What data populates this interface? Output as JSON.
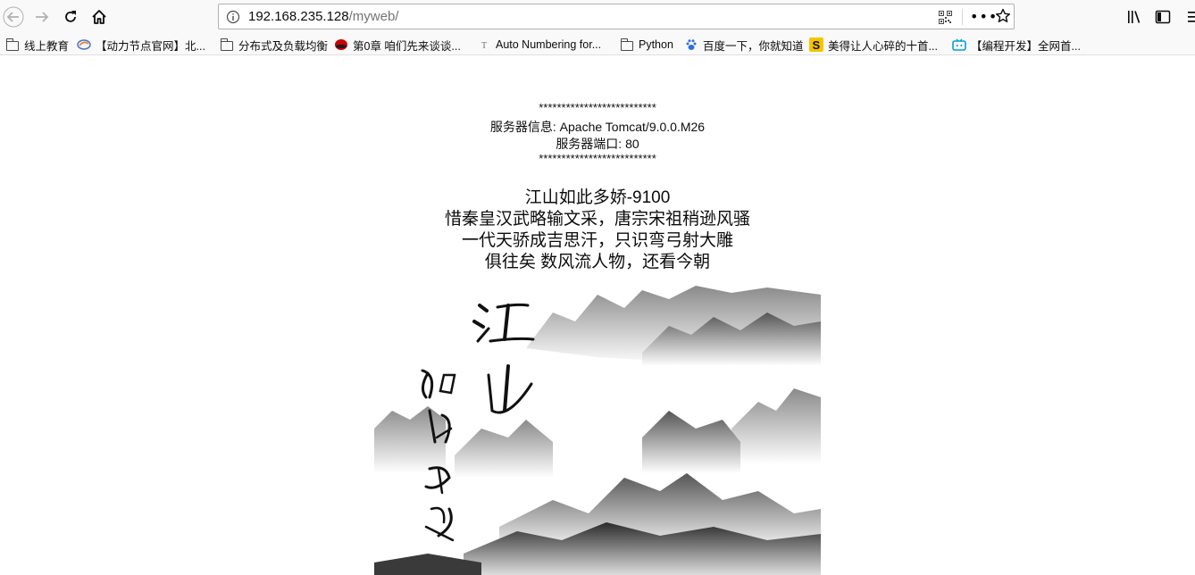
{
  "browser": {
    "url_host": "192.168.235.128",
    "url_path": "/myweb/",
    "more_label": "•••"
  },
  "bookmarks": [
    {
      "label": "线上教育",
      "icon": "folder-icon"
    },
    {
      "label": "【动力节点官网】北...",
      "icon": "site-icon"
    },
    {
      "label": "分布式及负载均衡",
      "icon": "folder-icon"
    },
    {
      "label": "第0章 咱们先来谈谈...",
      "icon": "redhat-icon"
    },
    {
      "label": "Auto Numbering for...",
      "icon": "page-icon"
    },
    {
      "label": "Python",
      "icon": "folder-icon"
    },
    {
      "label": "百度一下，你就知道",
      "icon": "baidu-paw-icon"
    },
    {
      "label": "美得让人心碎的十首...",
      "icon": "s-logo-icon"
    },
    {
      "label": "【编程开发】全网首...",
      "icon": "bilibili-tv-icon"
    }
  ],
  "page": {
    "stars_top": "**************************",
    "server_info": "服务器信息: Apache Tomcat/9.0.0.M26",
    "server_port": "服务器端口: 80",
    "stars_bottom": "**************************",
    "poem": [
      "江山如此多娇-9100",
      "惜秦皇汉武略输文采，唐宗宋祖稍逊风骚",
      "一代天骄成吉思汗，只识弯弓射大雕",
      "俱往矣 数风流人物，还看今朝"
    ]
  }
}
